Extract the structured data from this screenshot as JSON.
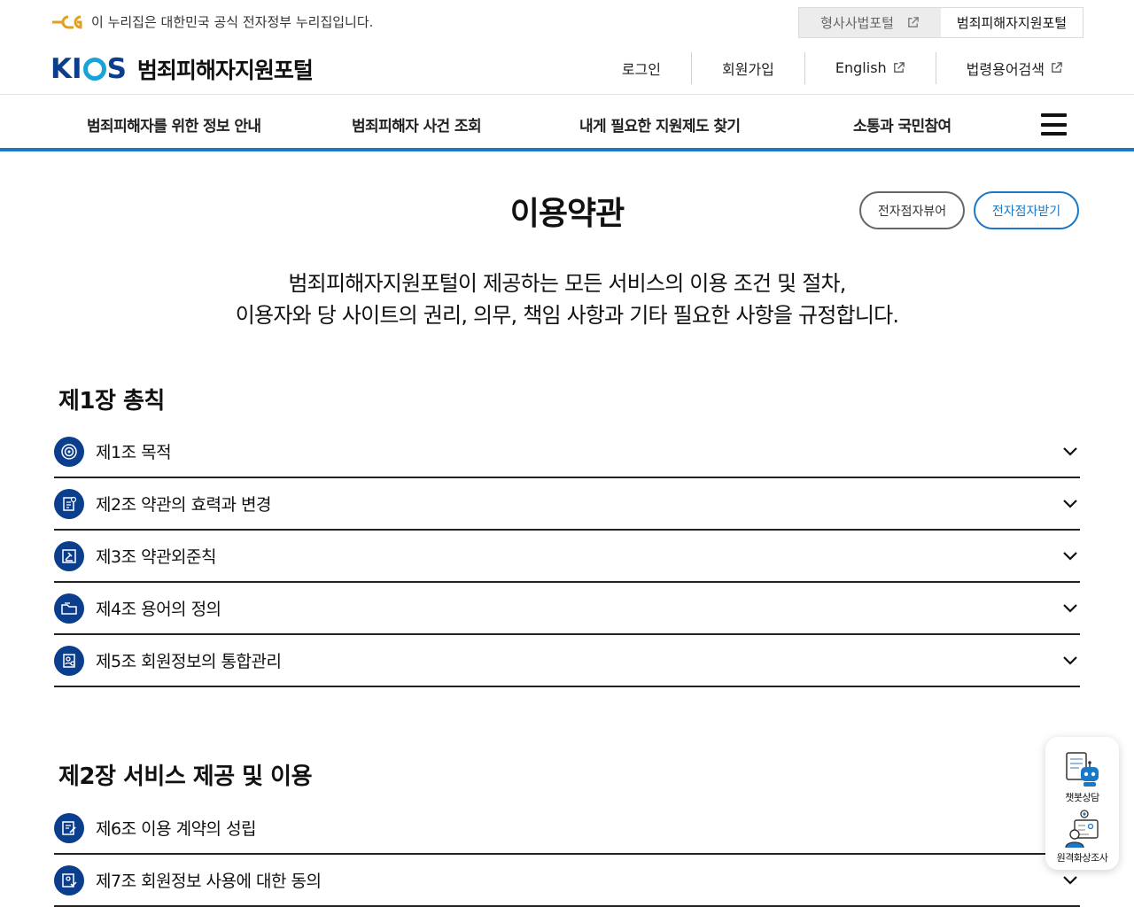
{
  "gov_bar": {
    "notice": "이 누리집은 대한민국 공식 전자정부 누리집입니다.",
    "portal_switch": [
      {
        "label": "형사사법포털",
        "active": false
      },
      {
        "label": "범죄피해자지원포털",
        "active": true
      }
    ]
  },
  "header": {
    "brand_logo": "KIOS",
    "brand_name": "범죄피해자지원포털",
    "util_nav": [
      {
        "label": "로그인"
      },
      {
        "label": "회원가입"
      },
      {
        "label": "English"
      },
      {
        "label": "법령용어검색"
      }
    ]
  },
  "gnb": {
    "items": [
      {
        "label": "범죄피해자를 위한 정보 안내"
      },
      {
        "label": "범죄피해자 사건 조회"
      },
      {
        "label": "내게 필요한 지원제도 찾기"
      },
      {
        "label": "소통과 국민참여"
      }
    ]
  },
  "page": {
    "title": "이용약관",
    "btn_viewer": "전자점자뷰어",
    "btn_download": "전자점자받기",
    "intro_line1": "범죄피해자지원포털이 제공하는 모든 서비스의 이용 조건 및 절차,",
    "intro_line2": "이용자와 당 사이트의 권리, 의무, 책임 사항과 기타 필요한 사항을 규정합니다."
  },
  "chapters": [
    {
      "title": "제1장 총칙",
      "articles": [
        {
          "label": "제1조 목적",
          "icon": "target-icon"
        },
        {
          "label": "제2조 약관의 효력과 변경",
          "icon": "document-edit-icon"
        },
        {
          "label": "제3조 약관외준칙",
          "icon": "gavel-icon"
        },
        {
          "label": "제4조 용어의 정의",
          "icon": "folder-icon"
        },
        {
          "label": "제5조 회원정보의 통합관리",
          "icon": "user-doc-icon"
        }
      ]
    },
    {
      "title": "제2장 서비스 제공 및 이용",
      "articles": [
        {
          "label": "제6조 이용 계약의 성립",
          "icon": "contract-sign-icon"
        },
        {
          "label": "제7조 회원정보 사용에 대한 동의",
          "icon": "user-check-icon"
        }
      ]
    }
  ],
  "float_widget": {
    "chatbot": "챗봇상담",
    "video": "원격화상조사"
  },
  "colors": {
    "brand_navy": "#0b3e8c",
    "accent_blue": "#1a78c8",
    "brand_cyan": "#1aa3d8"
  }
}
